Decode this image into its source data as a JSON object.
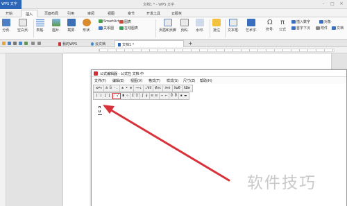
{
  "app": {
    "badge_label": "WPS 文字",
    "window_title": "文档1 * - WPS 文字",
    "controls": {
      "minimize": "–",
      "maximize": "□",
      "close": "✕"
    }
  },
  "ribbon": {
    "tabs": [
      "开始",
      "插入",
      "页面布局",
      "引用",
      "审阅",
      "视图",
      "章节",
      "开发工具",
      "云服务"
    ],
    "active_tab": "插入",
    "groups": [
      {
        "label": "分页·",
        "icon": "page-break-icon"
      },
      {
        "label": "空白页·",
        "icon": "blank-page-icon"
      },
      {
        "label": "表格·",
        "icon": "table-icon"
      },
      {
        "label": "图片·",
        "icon": "picture-icon"
      },
      {
        "label": "截屏·",
        "icon": "screenshot-icon"
      },
      {
        "label": "形状·",
        "icon": "shape-icon"
      },
      {
        "label": "SmartArt",
        "icon": "smartart-icon"
      },
      {
        "label": "图表",
        "icon": "chart-icon"
      },
      {
        "label": "关系图",
        "icon": "relation-icon"
      },
      {
        "label": "在线图表",
        "icon": "online-chart-icon"
      },
      {
        "label": "页眉和页脚",
        "icon": "header-footer-icon"
      },
      {
        "label": "页码·",
        "icon": "page-number-icon"
      },
      {
        "label": "水印·",
        "icon": "watermark-icon"
      },
      {
        "label": "批注",
        "icon": "comment-icon"
      },
      {
        "label": "文本框·",
        "icon": "textbox-icon"
      },
      {
        "label": "艺术字·",
        "icon": "wordart-icon"
      },
      {
        "label": "符号·",
        "icon": "symbol-icon",
        "glyph": "Ω"
      },
      {
        "label": "公式",
        "icon": "formula-icon",
        "glyph": "π"
      },
      {
        "label": "插入数字",
        "icon": "insert-number-icon"
      },
      {
        "label": "对象·",
        "icon": "object-icon"
      },
      {
        "label": "首字下沉",
        "icon": "dropcap-icon"
      },
      {
        "label": "附件",
        "icon": "attachment-icon"
      },
      {
        "label": "文档",
        "icon": "document-icon"
      }
    ]
  },
  "doc_tabs": {
    "items": [
      {
        "label": "我的WPS",
        "icon": "wps-home-icon"
      },
      {
        "label": "云文档",
        "icon": "cloud-doc-icon"
      },
      {
        "label": "文档1 *",
        "icon": "doc-icon"
      }
    ],
    "active": "文档1 *",
    "add_label": "+"
  },
  "equation_editor": {
    "title": "公式编辑器 - 公式在 文档 中",
    "menu": [
      "文件(F)",
      "编辑(E)",
      "视图(V)",
      "格式(T)",
      "样式(S)",
      "尺寸(Z)",
      "帮助(H)"
    ],
    "palette_row1": [
      "≤≠≈",
      "ȧ b̈ ·.",
      "± • ⊗",
      "→⇔↓",
      "∴∀∃",
      "∉∩⊂",
      "∂∞ℓ",
      "λωθ",
      "ΛΩ⊗"
    ],
    "palette_row2": [
      "(¨) [¨]",
      "⁄ √",
      "∎ ∘",
      "Σ̈ Σ̈",
      "∫ ∮",
      "⊡ ⊡",
      "→ ←",
      "Ū Ů",
      "▪ ▬"
    ],
    "highlighted_button": "⁄ √"
  },
  "watermark": {
    "text": "软件技巧"
  },
  "colors": {
    "wps_blue": "#2b66b8",
    "annotation_red": "#d8323b"
  }
}
